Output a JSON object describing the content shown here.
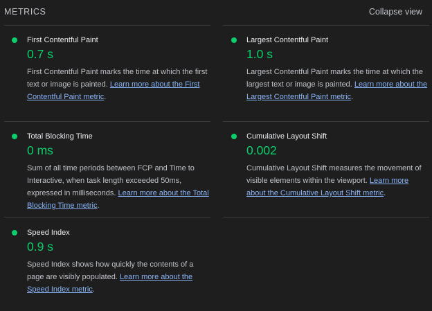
{
  "section": {
    "title": "METRICS",
    "toggle_label": "Collapse view"
  },
  "colors": {
    "background": "#1e1e1e",
    "pass_green": "#0cce6b",
    "link_blue": "#8ab4f8"
  },
  "metrics": [
    {
      "title": "First Contentful Paint",
      "value": "0.7 s",
      "description": "First Contentful Paint marks the time at which the first text or image is painted. ",
      "link": "Learn more about the First Contentful Paint metric",
      "after": "."
    },
    {
      "title": "Largest Contentful Paint",
      "value": "1.0 s",
      "description": "Largest Contentful Paint marks the time at which the largest text or image is painted. ",
      "link": "Learn more about the Largest Contentful Paint metric",
      "after": "."
    },
    {
      "title": "Total Blocking Time",
      "value": "0 ms",
      "description": "Sum of all time periods between FCP and Time to Interactive, when task length exceeded 50ms, expressed in milliseconds. ",
      "link": "Learn more about the Total Blocking Time metric",
      "after": "."
    },
    {
      "title": "Cumulative Layout Shift",
      "value": "0.002",
      "description": "Cumulative Layout Shift measures the movement of visible elements within the viewport. ",
      "link": "Learn more about the Cumulative Layout Shift metric",
      "after": "."
    },
    {
      "title": "Speed Index",
      "value": "0.9 s",
      "description": "Speed Index shows how quickly the contents of a page are visibly populated. ",
      "link": "Learn more about the Speed Index metric",
      "after": "."
    }
  ]
}
